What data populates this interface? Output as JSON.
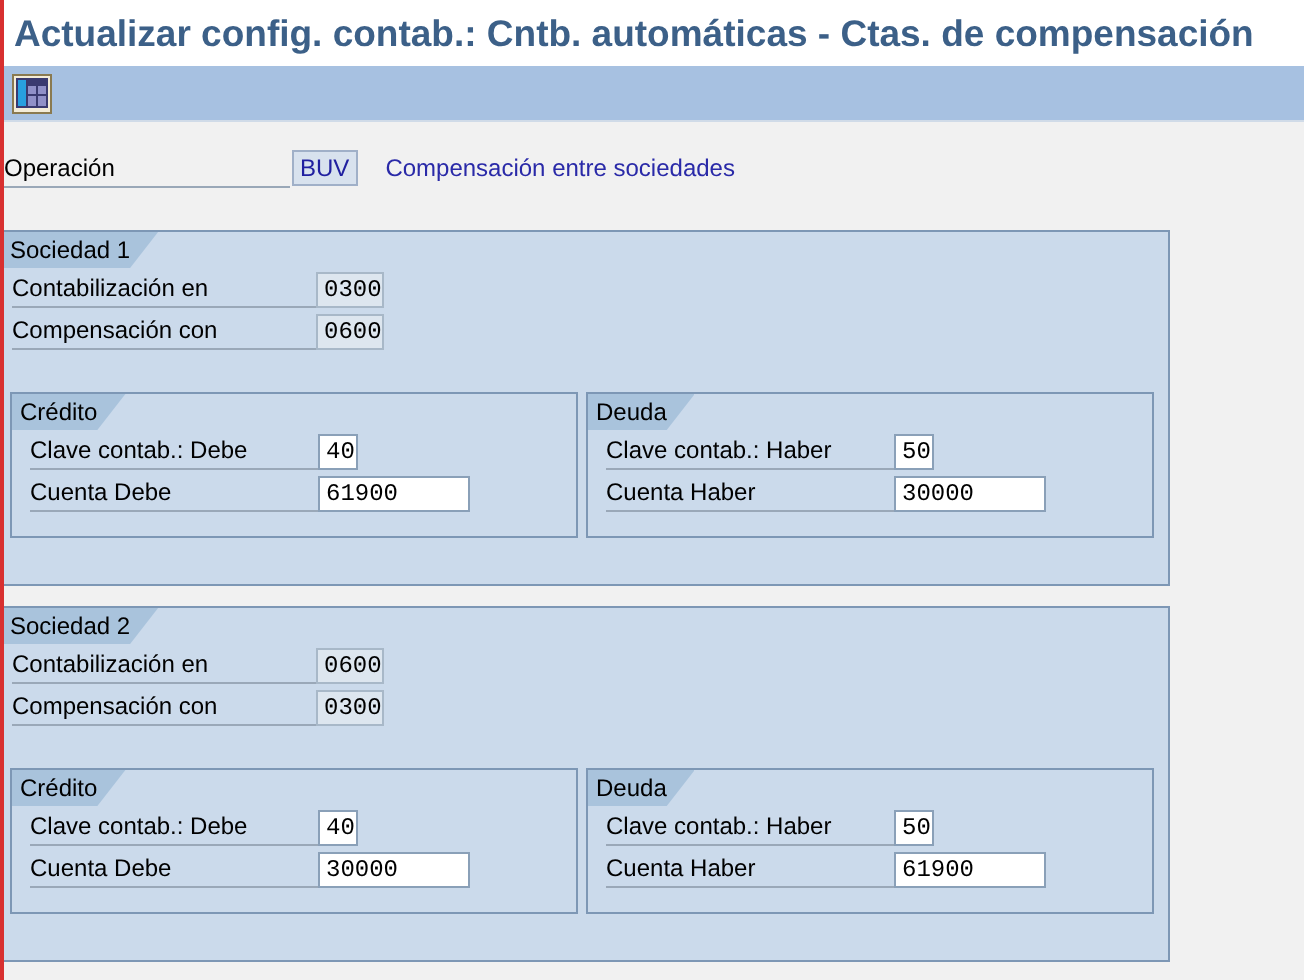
{
  "window": {
    "title": "Actualizar config. contab.: Cntb. automáticas - Ctas. de compensación"
  },
  "operation": {
    "label": "Operación",
    "value": "BUV",
    "description": "Compensación entre sociedades"
  },
  "companies": [
    {
      "title": "Sociedad 1",
      "fields": [
        {
          "label": "Contabilización en",
          "value": "0300",
          "kind": "display"
        },
        {
          "label": "Compensación con",
          "value": "0600",
          "kind": "display"
        }
      ],
      "subgroups": [
        {
          "title": "Crédito",
          "fields": [
            {
              "label": "Clave contab.: Debe",
              "value": "40",
              "kind": "input"
            },
            {
              "label": "Cuenta Debe",
              "value": "61900",
              "kind": "input"
            }
          ]
        },
        {
          "title": "Deuda",
          "fields": [
            {
              "label": "Clave contab.: Haber",
              "value": "50",
              "kind": "input"
            },
            {
              "label": "Cuenta Haber",
              "value": "30000",
              "kind": "input"
            }
          ]
        }
      ]
    },
    {
      "title": "Sociedad 2",
      "fields": [
        {
          "label": "Contabilización en",
          "value": "0600",
          "kind": "display"
        },
        {
          "label": "Compensación con",
          "value": "0300",
          "kind": "display"
        }
      ],
      "subgroups": [
        {
          "title": "Crédito",
          "fields": [
            {
              "label": "Clave contab.: Debe",
              "value": "40",
              "kind": "input"
            },
            {
              "label": "Cuenta Debe",
              "value": "30000",
              "kind": "input"
            }
          ]
        },
        {
          "title": "Deuda",
          "fields": [
            {
              "label": "Clave contab.: Haber",
              "value": "50",
              "kind": "input"
            },
            {
              "label": "Cuenta Haber",
              "value": "61900",
              "kind": "input"
            }
          ]
        }
      ]
    }
  ]
}
